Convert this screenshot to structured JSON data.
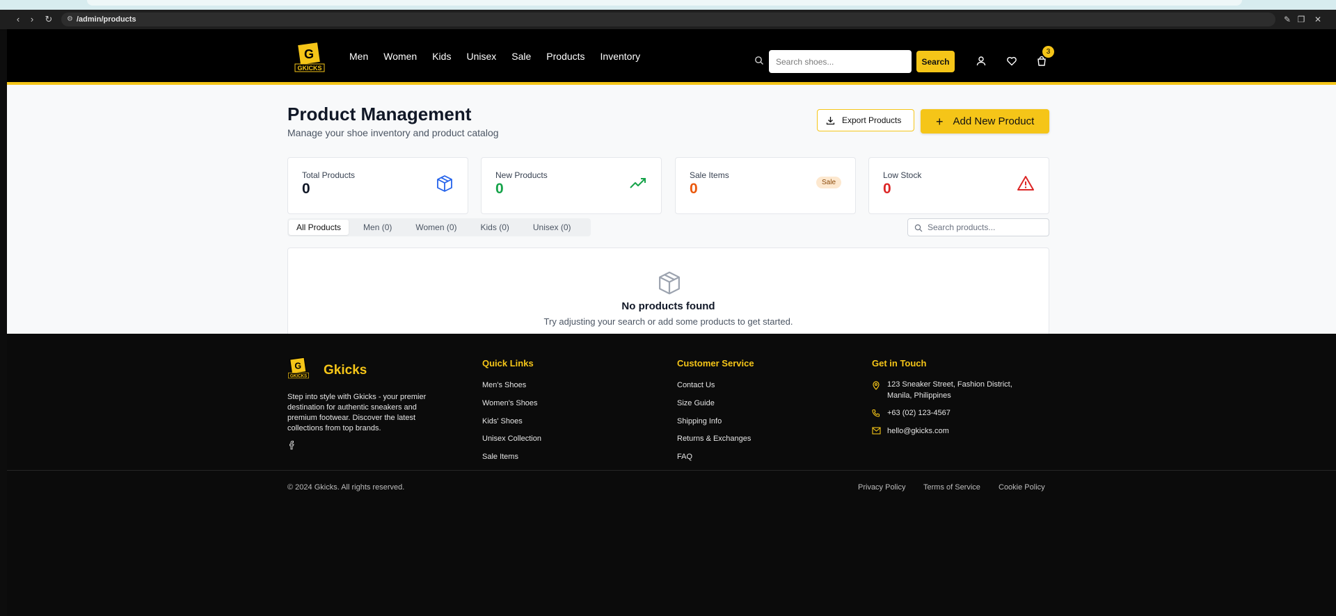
{
  "browser": {
    "url": "/admin/products"
  },
  "header": {
    "logo_alt": "Gkicks logo",
    "nav": [
      "Men",
      "Women",
      "Kids",
      "Unisex",
      "Sale",
      "Products",
      "Inventory"
    ],
    "search_placeholder": "Search shoes...",
    "search_button": "Search",
    "cart_count": "3"
  },
  "page": {
    "title": "Product Management",
    "subtitle": "Manage your shoe inventory and product catalog",
    "export_label": "Export Products",
    "add_label": "Add New Product"
  },
  "stats": [
    {
      "label": "Total Products",
      "value": "0",
      "color": "#111827",
      "icon": "box-icon"
    },
    {
      "label": "New Products",
      "value": "0",
      "color": "#16a34a",
      "icon": "trending-up-icon"
    },
    {
      "label": "Sale Items",
      "value": "0",
      "color": "#ea580c",
      "icon": "sale-badge",
      "badge": "Sale"
    },
    {
      "label": "Low Stock",
      "value": "0",
      "color": "#dc2626",
      "icon": "warning-icon"
    }
  ],
  "tabs": [
    "All Products",
    "Men (0)",
    "Women (0)",
    "Kids (0)",
    "Unisex (0)"
  ],
  "products_search_placeholder": "Search products...",
  "empty": {
    "title": "No products found",
    "text": "Try adjusting your search or add some products to get started."
  },
  "footer": {
    "brand": "Gkicks",
    "description": "Step into style with Gkicks - your premier destination for authentic sneakers and premium footwear. Discover the latest collections from top brands.",
    "quick_links_title": "Quick Links",
    "quick_links": [
      "Men's Shoes",
      "Women's Shoes",
      "Kids' Shoes",
      "Unisex Collection",
      "Sale Items"
    ],
    "service_title": "Customer Service",
    "service_links": [
      "Contact Us",
      "Size Guide",
      "Shipping Info",
      "Returns & Exchanges",
      "FAQ"
    ],
    "contact_title": "Get in Touch",
    "address_line1": "123 Sneaker Street, Fashion District,",
    "address_line2": "Manila, Philippines",
    "phone": "+63 (02) 123-4567",
    "email": "hello@gkicks.com",
    "copyright": "© 2024 Gkicks. All rights reserved.",
    "legal": [
      "Privacy Policy",
      "Terms of Service",
      "Cookie Policy"
    ]
  },
  "colors": {
    "accent": "#f5c518",
    "header_bg": "#000000",
    "page_bg": "#f8f9fa"
  }
}
